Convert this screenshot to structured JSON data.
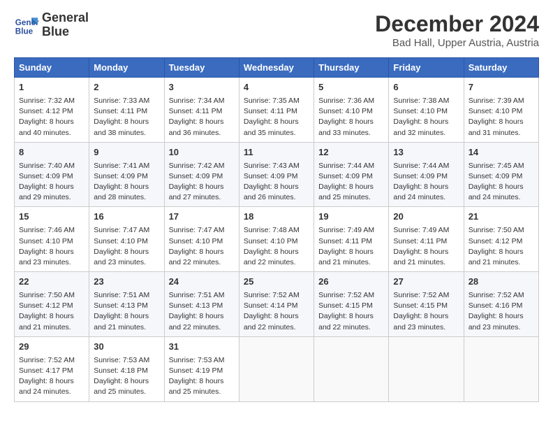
{
  "header": {
    "logo_line1": "General",
    "logo_line2": "Blue",
    "month": "December 2024",
    "location": "Bad Hall, Upper Austria, Austria"
  },
  "days_of_week": [
    "Sunday",
    "Monday",
    "Tuesday",
    "Wednesday",
    "Thursday",
    "Friday",
    "Saturday"
  ],
  "weeks": [
    [
      {
        "day": "1",
        "lines": [
          "Sunrise: 7:32 AM",
          "Sunset: 4:12 PM",
          "Daylight: 8 hours",
          "and 40 minutes."
        ]
      },
      {
        "day": "2",
        "lines": [
          "Sunrise: 7:33 AM",
          "Sunset: 4:11 PM",
          "Daylight: 8 hours",
          "and 38 minutes."
        ]
      },
      {
        "day": "3",
        "lines": [
          "Sunrise: 7:34 AM",
          "Sunset: 4:11 PM",
          "Daylight: 8 hours",
          "and 36 minutes."
        ]
      },
      {
        "day": "4",
        "lines": [
          "Sunrise: 7:35 AM",
          "Sunset: 4:11 PM",
          "Daylight: 8 hours",
          "and 35 minutes."
        ]
      },
      {
        "day": "5",
        "lines": [
          "Sunrise: 7:36 AM",
          "Sunset: 4:10 PM",
          "Daylight: 8 hours",
          "and 33 minutes."
        ]
      },
      {
        "day": "6",
        "lines": [
          "Sunrise: 7:38 AM",
          "Sunset: 4:10 PM",
          "Daylight: 8 hours",
          "and 32 minutes."
        ]
      },
      {
        "day": "7",
        "lines": [
          "Sunrise: 7:39 AM",
          "Sunset: 4:10 PM",
          "Daylight: 8 hours",
          "and 31 minutes."
        ]
      }
    ],
    [
      {
        "day": "8",
        "lines": [
          "Sunrise: 7:40 AM",
          "Sunset: 4:09 PM",
          "Daylight: 8 hours",
          "and 29 minutes."
        ]
      },
      {
        "day": "9",
        "lines": [
          "Sunrise: 7:41 AM",
          "Sunset: 4:09 PM",
          "Daylight: 8 hours",
          "and 28 minutes."
        ]
      },
      {
        "day": "10",
        "lines": [
          "Sunrise: 7:42 AM",
          "Sunset: 4:09 PM",
          "Daylight: 8 hours",
          "and 27 minutes."
        ]
      },
      {
        "day": "11",
        "lines": [
          "Sunrise: 7:43 AM",
          "Sunset: 4:09 PM",
          "Daylight: 8 hours",
          "and 26 minutes."
        ]
      },
      {
        "day": "12",
        "lines": [
          "Sunrise: 7:44 AM",
          "Sunset: 4:09 PM",
          "Daylight: 8 hours",
          "and 25 minutes."
        ]
      },
      {
        "day": "13",
        "lines": [
          "Sunrise: 7:44 AM",
          "Sunset: 4:09 PM",
          "Daylight: 8 hours",
          "and 24 minutes."
        ]
      },
      {
        "day": "14",
        "lines": [
          "Sunrise: 7:45 AM",
          "Sunset: 4:09 PM",
          "Daylight: 8 hours",
          "and 24 minutes."
        ]
      }
    ],
    [
      {
        "day": "15",
        "lines": [
          "Sunrise: 7:46 AM",
          "Sunset: 4:10 PM",
          "Daylight: 8 hours",
          "and 23 minutes."
        ]
      },
      {
        "day": "16",
        "lines": [
          "Sunrise: 7:47 AM",
          "Sunset: 4:10 PM",
          "Daylight: 8 hours",
          "and 23 minutes."
        ]
      },
      {
        "day": "17",
        "lines": [
          "Sunrise: 7:47 AM",
          "Sunset: 4:10 PM",
          "Daylight: 8 hours",
          "and 22 minutes."
        ]
      },
      {
        "day": "18",
        "lines": [
          "Sunrise: 7:48 AM",
          "Sunset: 4:10 PM",
          "Daylight: 8 hours",
          "and 22 minutes."
        ]
      },
      {
        "day": "19",
        "lines": [
          "Sunrise: 7:49 AM",
          "Sunset: 4:11 PM",
          "Daylight: 8 hours",
          "and 21 minutes."
        ]
      },
      {
        "day": "20",
        "lines": [
          "Sunrise: 7:49 AM",
          "Sunset: 4:11 PM",
          "Daylight: 8 hours",
          "and 21 minutes."
        ]
      },
      {
        "day": "21",
        "lines": [
          "Sunrise: 7:50 AM",
          "Sunset: 4:12 PM",
          "Daylight: 8 hours",
          "and 21 minutes."
        ]
      }
    ],
    [
      {
        "day": "22",
        "lines": [
          "Sunrise: 7:50 AM",
          "Sunset: 4:12 PM",
          "Daylight: 8 hours",
          "and 21 minutes."
        ]
      },
      {
        "day": "23",
        "lines": [
          "Sunrise: 7:51 AM",
          "Sunset: 4:13 PM",
          "Daylight: 8 hours",
          "and 21 minutes."
        ]
      },
      {
        "day": "24",
        "lines": [
          "Sunrise: 7:51 AM",
          "Sunset: 4:13 PM",
          "Daylight: 8 hours",
          "and 22 minutes."
        ]
      },
      {
        "day": "25",
        "lines": [
          "Sunrise: 7:52 AM",
          "Sunset: 4:14 PM",
          "Daylight: 8 hours",
          "and 22 minutes."
        ]
      },
      {
        "day": "26",
        "lines": [
          "Sunrise: 7:52 AM",
          "Sunset: 4:15 PM",
          "Daylight: 8 hours",
          "and 22 minutes."
        ]
      },
      {
        "day": "27",
        "lines": [
          "Sunrise: 7:52 AM",
          "Sunset: 4:15 PM",
          "Daylight: 8 hours",
          "and 23 minutes."
        ]
      },
      {
        "day": "28",
        "lines": [
          "Sunrise: 7:52 AM",
          "Sunset: 4:16 PM",
          "Daylight: 8 hours",
          "and 23 minutes."
        ]
      }
    ],
    [
      {
        "day": "29",
        "lines": [
          "Sunrise: 7:52 AM",
          "Sunset: 4:17 PM",
          "Daylight: 8 hours",
          "and 24 minutes."
        ]
      },
      {
        "day": "30",
        "lines": [
          "Sunrise: 7:53 AM",
          "Sunset: 4:18 PM",
          "Daylight: 8 hours",
          "and 25 minutes."
        ]
      },
      {
        "day": "31",
        "lines": [
          "Sunrise: 7:53 AM",
          "Sunset: 4:19 PM",
          "Daylight: 8 hours",
          "and 25 minutes."
        ]
      },
      {
        "day": "",
        "lines": []
      },
      {
        "day": "",
        "lines": []
      },
      {
        "day": "",
        "lines": []
      },
      {
        "day": "",
        "lines": []
      }
    ]
  ]
}
